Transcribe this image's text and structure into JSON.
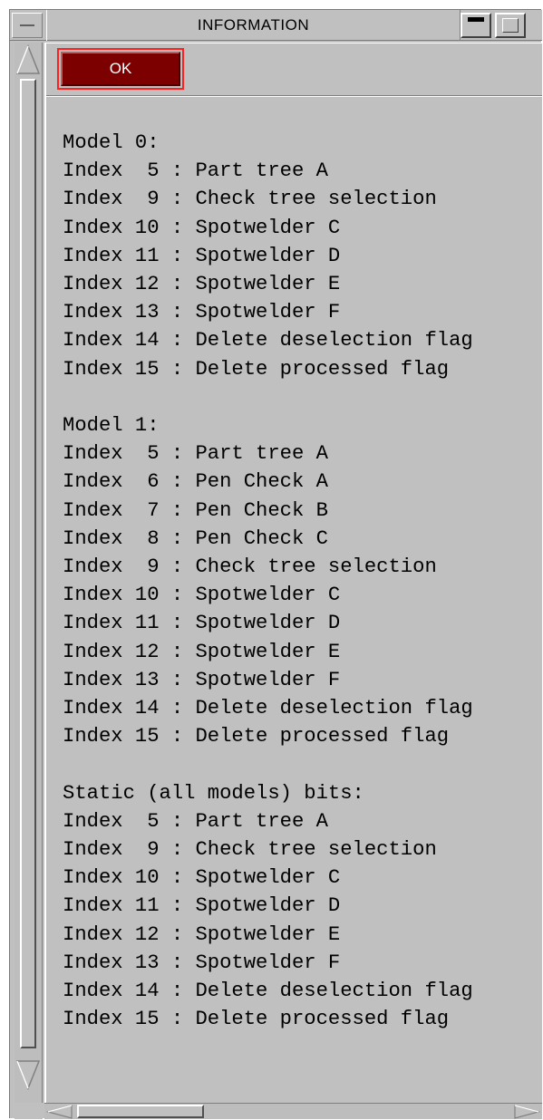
{
  "window": {
    "title": "INFORMATION"
  },
  "buttons": {
    "ok_label": "OK"
  },
  "sections": [
    {
      "header": "Model 0:",
      "lines": [
        "Index  5 : Part tree A",
        "Index  9 : Check tree selection",
        "Index 10 : Spotwelder C",
        "Index 11 : Spotwelder D",
        "Index 12 : Spotwelder E",
        "Index 13 : Spotwelder F",
        "Index 14 : Delete deselection flag",
        "Index 15 : Delete processed flag"
      ]
    },
    {
      "header": "Model 1:",
      "lines": [
        "Index  5 : Part tree A",
        "Index  6 : Pen Check A",
        "Index  7 : Pen Check B",
        "Index  8 : Pen Check C",
        "Index  9 : Check tree selection",
        "Index 10 : Spotwelder C",
        "Index 11 : Spotwelder D",
        "Index 12 : Spotwelder E",
        "Index 13 : Spotwelder F",
        "Index 14 : Delete deselection flag",
        "Index 15 : Delete processed flag"
      ]
    },
    {
      "header": "Static (all models) bits:",
      "lines": [
        "Index  5 : Part tree A",
        "Index  9 : Check tree selection",
        "Index 10 : Spotwelder C",
        "Index 11 : Spotwelder D",
        "Index 12 : Spotwelder E",
        "Index 13 : Spotwelder F",
        "Index 14 : Delete deselection flag",
        "Index 15 : Delete processed flag"
      ]
    }
  ],
  "colors": {
    "panel_bg": "#c0c0c0",
    "ok_button_bg": "#7d0000",
    "ok_focus_border": "#ff2020"
  }
}
